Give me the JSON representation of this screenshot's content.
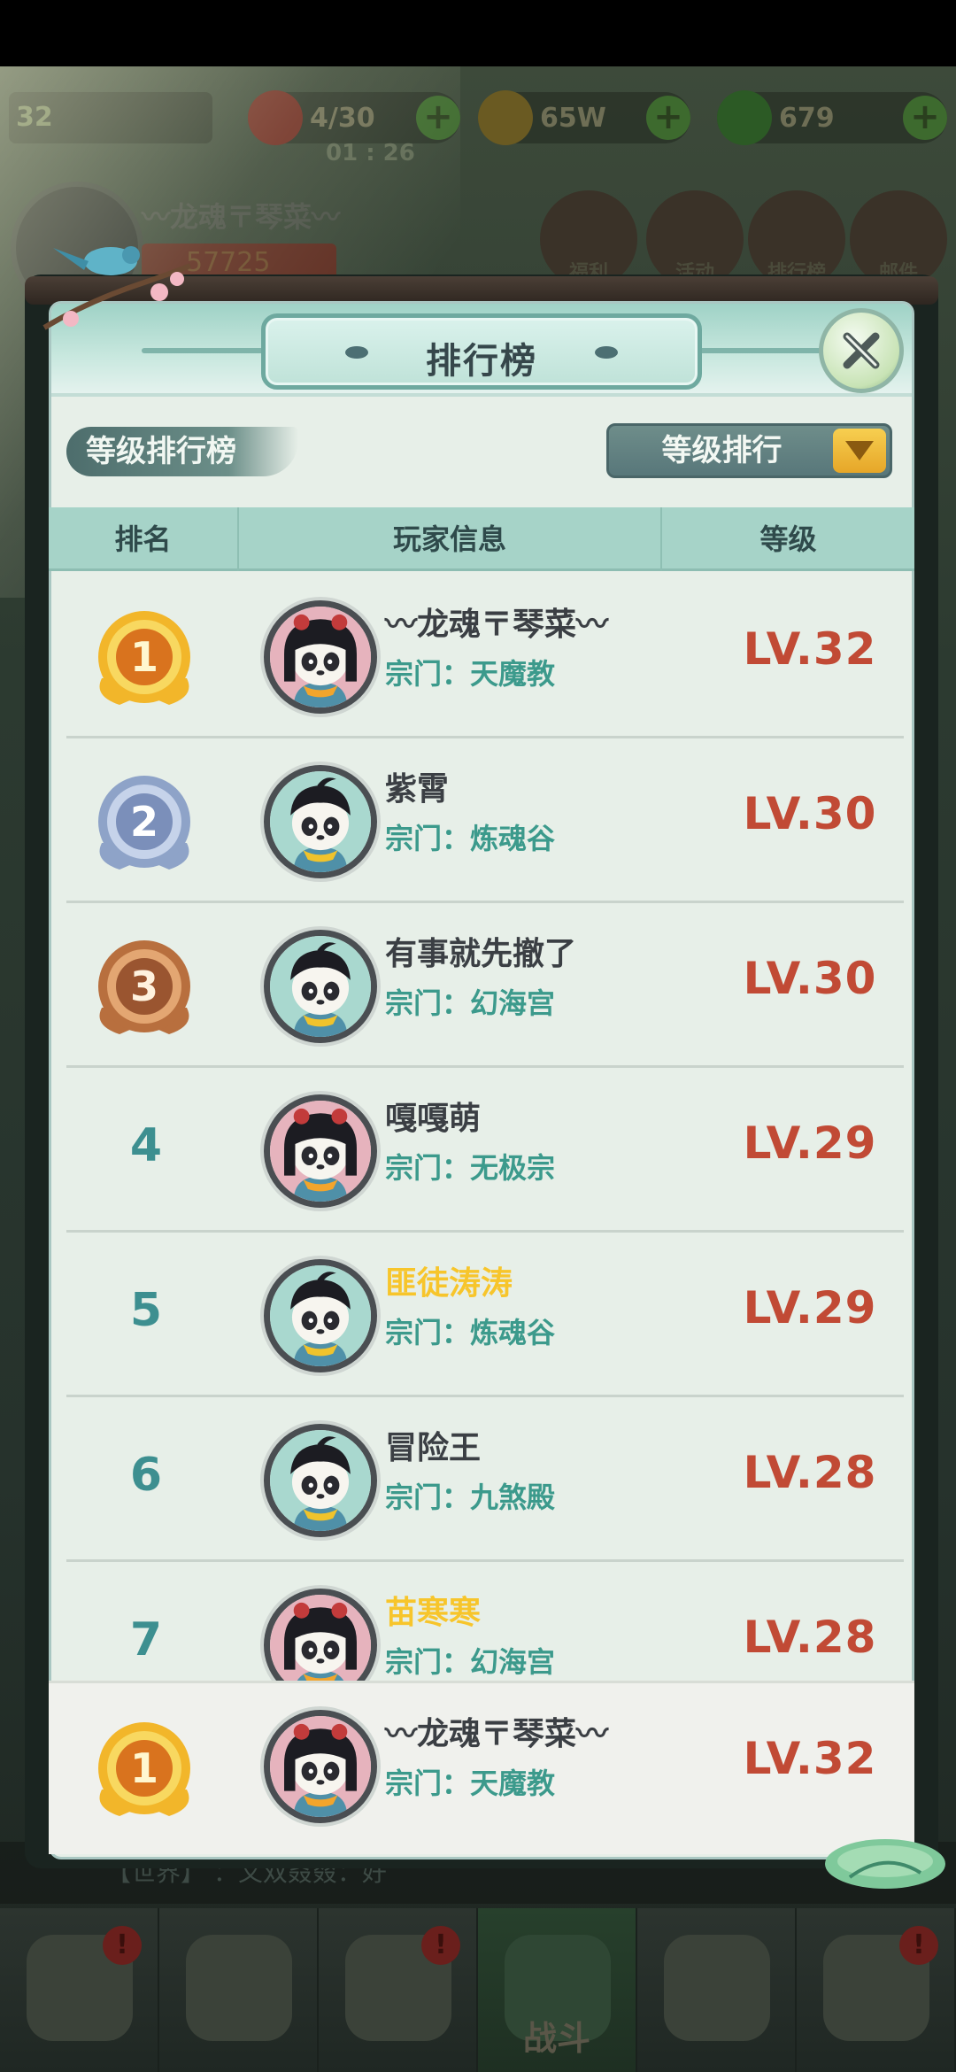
{
  "hud": {
    "player_level": "32",
    "stamina": "4/30",
    "stamina_timer": "01 : 26",
    "gold": "65W",
    "jade": "679",
    "player_name_bg": "〰龙魂〒琴菜〰",
    "power": "57725",
    "menu": [
      "福利",
      "活动",
      "排行榜",
      "邮件"
    ]
  },
  "panel": {
    "title": "排行榜",
    "board_tag": "等级排行榜",
    "sort_dropdown": "等级排行",
    "columns": [
      "排名",
      "玩家信息",
      "等级"
    ]
  },
  "ranking": [
    {
      "rank": "1",
      "name": "〰龙魂〒琴菜〰",
      "sect_label": "宗门：",
      "sect": "天魔教",
      "level": "LV.32",
      "gender": "female",
      "name_color": "normal"
    },
    {
      "rank": "2",
      "name": "紫霄",
      "sect_label": "宗门：",
      "sect": "炼魂谷",
      "level": "LV.30",
      "gender": "male",
      "name_color": "normal"
    },
    {
      "rank": "3",
      "name": "有事就先撤了",
      "sect_label": "宗门：",
      "sect": "幻海宫",
      "level": "LV.30",
      "gender": "male",
      "name_color": "normal"
    },
    {
      "rank": "4",
      "name": "嘎嘎萌",
      "sect_label": "宗门：",
      "sect": "无极宗",
      "level": "LV.29",
      "gender": "female",
      "name_color": "normal"
    },
    {
      "rank": "5",
      "name": "匪徒涛涛",
      "sect_label": "宗门：",
      "sect": "炼魂谷",
      "level": "LV.29",
      "gender": "male",
      "name_color": "gold"
    },
    {
      "rank": "6",
      "name": "冒险王",
      "sect_label": "宗门：",
      "sect": "九煞殿",
      "level": "LV.28",
      "gender": "male",
      "name_color": "normal"
    },
    {
      "rank": "7",
      "name": "苗寒寒",
      "sect_label": "宗门：",
      "sect": "幻海宫",
      "level": "LV.28",
      "gender": "female",
      "name_color": "gold"
    }
  ],
  "self": {
    "rank": "1",
    "name": "〰龙魂〒琴菜〰",
    "sect_label": "宗门：",
    "sect": "天魔教",
    "level": "LV.32"
  },
  "chat_preview": "【世界】 ：又双叒叕：好",
  "bottom_nav": {
    "battle_label": "战斗"
  },
  "colors": {
    "level": "#c14a35",
    "sect": "#3c9a8c",
    "rank_num": "#3d8f90",
    "gold_name": "#f7c52b"
  }
}
